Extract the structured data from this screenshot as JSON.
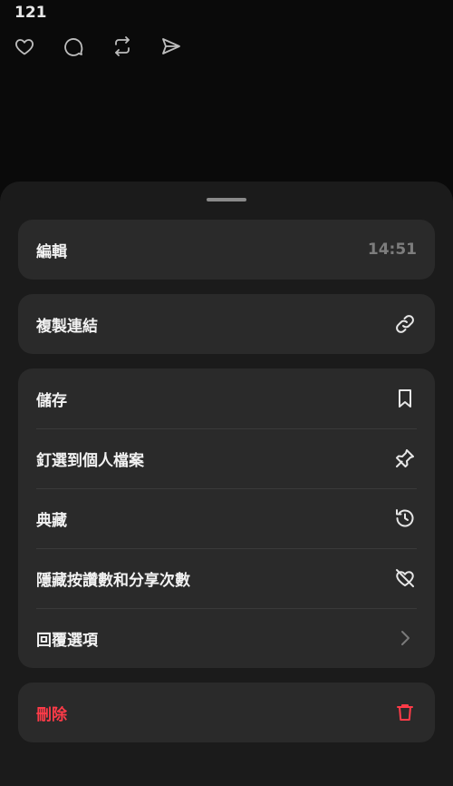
{
  "post": {
    "like_count": "121",
    "icons": [
      "heart-icon",
      "comment-icon",
      "repost-icon",
      "share-icon"
    ]
  },
  "menu": {
    "edit": {
      "label": "編輯",
      "time": "14:51"
    },
    "copy_link": {
      "label": "複製連結",
      "icon": "link-icon"
    },
    "group": [
      {
        "label": "儲存",
        "icon": "bookmark-icon"
      },
      {
        "label": "釘選到個人檔案",
        "icon": "pin-icon"
      },
      {
        "label": "典藏",
        "icon": "archive-history-icon"
      },
      {
        "label": "隱藏按讚數和分享次數",
        "icon": "hide-likes-icon"
      },
      {
        "label": "回覆選項",
        "icon": "chevron-right-icon"
      }
    ],
    "delete": {
      "label": "刪除",
      "icon": "trash-icon",
      "color": "#ff3b48"
    }
  }
}
